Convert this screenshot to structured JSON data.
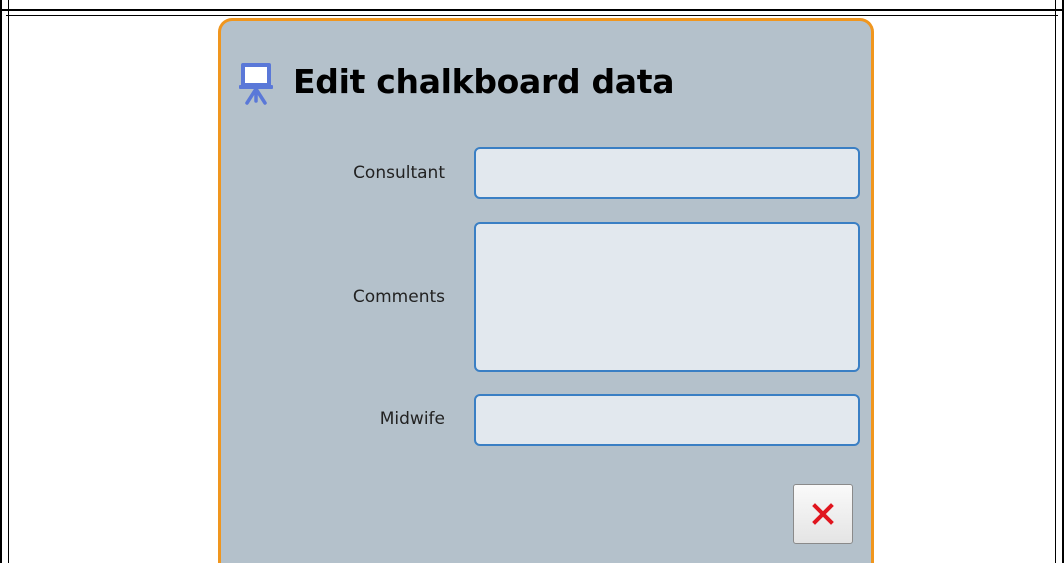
{
  "dialog": {
    "title": "Edit chalkboard data",
    "title_icon": "chalkboard-easel-icon",
    "accent_color": "#f0961e",
    "background_color": "#b4c1cb"
  },
  "fields": {
    "consultant": {
      "label": "Consultant",
      "value": "",
      "placeholder": ""
    },
    "comments": {
      "label": "Comments",
      "value": "",
      "placeholder": ""
    },
    "midwife": {
      "label": "Midwife",
      "value": "",
      "placeholder": ""
    }
  },
  "close_button": {
    "icon": "close-x-icon",
    "icon_color": "#e0151e"
  }
}
